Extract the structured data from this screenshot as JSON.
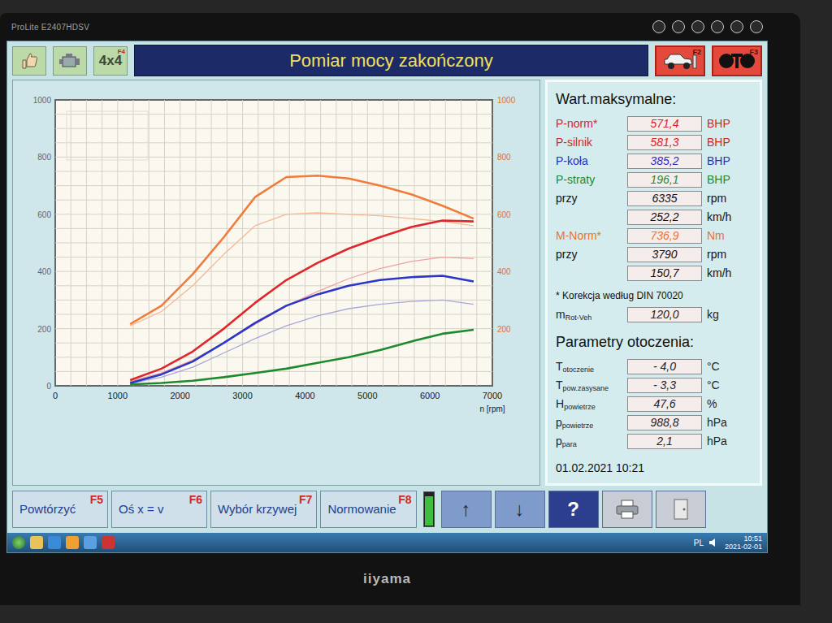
{
  "monitor": {
    "model": "ProLite E2407HDSV",
    "brand": "iiyama"
  },
  "toolbar": {
    "drive_mode": "4x4",
    "drive_key": "F4",
    "title": "Pomiar mocy zakończony",
    "buttons": [
      {
        "key": "F2",
        "kind": "car"
      },
      {
        "key": "F3",
        "kind": "rollers"
      }
    ]
  },
  "chart": {
    "x_max": 7000,
    "y_max": 1000,
    "x_ticks": [
      "0",
      "1000",
      "2000",
      "3000",
      "4000",
      "5000",
      "6000",
      "7000"
    ],
    "x_label": "n [rpm]",
    "left_ticks": [
      "0",
      "200",
      "400",
      "600",
      "800",
      "1000"
    ],
    "right_ticks": [
      "200",
      "400",
      "600",
      "800",
      "1000"
    ],
    "rpm": [
      1200,
      1700,
      2200,
      2700,
      3200,
      3700,
      4200,
      4700,
      5200,
      5700,
      6200,
      6700
    ],
    "series": [
      {
        "kind": "reference",
        "color": "#f3b995",
        "values": [
          210,
          260,
          350,
          460,
          560,
          600,
          605,
          600,
          595,
          585,
          575,
          560
        ]
      },
      {
        "kind": "reference",
        "color": "#f0a0a0",
        "values": [
          15,
          45,
          90,
          150,
          215,
          280,
          330,
          375,
          410,
          435,
          450,
          445
        ]
      },
      {
        "kind": "reference",
        "color": "#a8a8d8",
        "values": [
          8,
          30,
          65,
          115,
          165,
          210,
          245,
          270,
          285,
          295,
          300,
          285
        ]
      },
      {
        "kind": "main",
        "color": "#f07b3a",
        "values": [
          216,
          280,
          390,
          520,
          660,
          730,
          735,
          725,
          700,
          670,
          630,
          585
        ]
      },
      {
        "kind": "main",
        "color": "#e0262a",
        "values": [
          20,
          60,
          120,
          200,
          290,
          370,
          430,
          480,
          520,
          555,
          578,
          575
        ]
      },
      {
        "kind": "main",
        "color": "#2b35c8",
        "values": [
          10,
          40,
          85,
          150,
          220,
          280,
          320,
          350,
          370,
          380,
          385,
          365
        ]
      },
      {
        "kind": "main",
        "color": "#1e8a2e",
        "values": [
          5,
          10,
          18,
          30,
          45,
          60,
          80,
          100,
          125,
          155,
          182,
          196
        ]
      }
    ]
  },
  "max_values": {
    "title": "Wart.maksymalne:",
    "rows": [
      {
        "label": "P-norm*",
        "value": "571,4",
        "unit": "BHP",
        "color": "#d8232a"
      },
      {
        "label": "P-silnik",
        "value": "581,3",
        "unit": "BHP",
        "color": "#d8232a"
      },
      {
        "label": "P-koła",
        "value": "385,2",
        "unit": "BHP",
        "color": "#2a2fc0"
      },
      {
        "label": "P-straty",
        "value": "196,1",
        "unit": "BHP",
        "color": "#1e8a2e"
      },
      {
        "label": "przy",
        "value": "6335",
        "unit": "rpm",
        "color": "#111111"
      },
      {
        "value": "252,2",
        "unit": "km/h",
        "color": "#111111"
      },
      {
        "label": "M-Norm*",
        "value": "736,9",
        "unit": "Nm",
        "color": "#e8742c"
      },
      {
        "label": "przy",
        "value": "3790",
        "unit": "rpm",
        "color": "#111111"
      },
      {
        "value": "150,7",
        "unit": "km/h",
        "color": "#111111"
      }
    ]
  },
  "note": "* Korekcja według DIN 70020",
  "rot_mass": {
    "symbol": "m",
    "sub": "Rot-Veh",
    "value": "120,0",
    "unit": "kg"
  },
  "ambient": {
    "title": "Parametry otoczenia:",
    "rows": [
      {
        "symbol": "T",
        "sub": "otoczenie",
        "value": "- 4,0",
        "unit": "°C"
      },
      {
        "symbol": "T",
        "sub": "pow.zasysane",
        "value": "- 3,3",
        "unit": "°C"
      },
      {
        "symbol": "H",
        "sub": "powietrze",
        "value": "47,6",
        "unit": "%"
      },
      {
        "symbol": "p",
        "sub": "powietrze",
        "value": "988,8",
        "unit": "hPa"
      },
      {
        "symbol": "p",
        "sub": "para",
        "value": "2,1",
        "unit": "hPa"
      }
    ]
  },
  "timestamp": "01.02.2021 10:21",
  "bottom_bar": {
    "buttons": [
      {
        "label": "Powtórzyć",
        "key": "F5"
      },
      {
        "label": "Oś x = v",
        "key": "F6"
      },
      {
        "label": "Wybór krzywej",
        "key": "F7"
      },
      {
        "label": "Normowanie",
        "key": "F8"
      }
    ],
    "meter": {
      "level": 0.9
    },
    "nav_buttons": [
      {
        "glyph": "↑",
        "kind": "arrow"
      },
      {
        "glyph": "↓",
        "kind": "arrow"
      },
      {
        "glyph": "?",
        "kind": "help"
      }
    ]
  },
  "taskbar": {
    "lang": "PL",
    "time": "10:51",
    "date": "2021-02-01"
  }
}
